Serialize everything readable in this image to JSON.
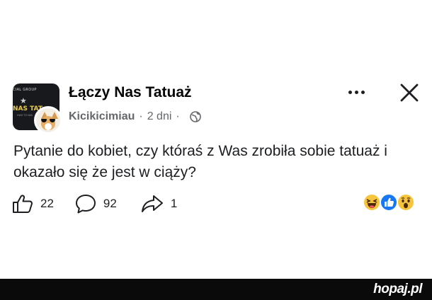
{
  "post": {
    "group_name": "Łączy Nas Tatuaż",
    "author": "Kicikicimiau",
    "separator": "·",
    "time": "2 dni",
    "text": "Pytanie do kobiet, czy któraś z Was zrobiła sobie tatuaż i okazało się że jest w ciąży?",
    "group_avatar": {
      "top_text": "CIAL GROUP",
      "name_text": "NAS TAT",
      "sub_text": "HAS TO MA"
    },
    "privacy_icon": "globe-icon"
  },
  "actions": {
    "likes": "22",
    "comments": "92",
    "shares": "1"
  },
  "reactions": [
    "haha",
    "like",
    "wow"
  ],
  "footer": {
    "brand": "hopaj.pl"
  },
  "colors": {
    "secondary_text": "#65676b",
    "like_blue": "#1877f2",
    "reaction_yellow": "#f7c53d",
    "footer_bg": "#0a0a0a"
  }
}
